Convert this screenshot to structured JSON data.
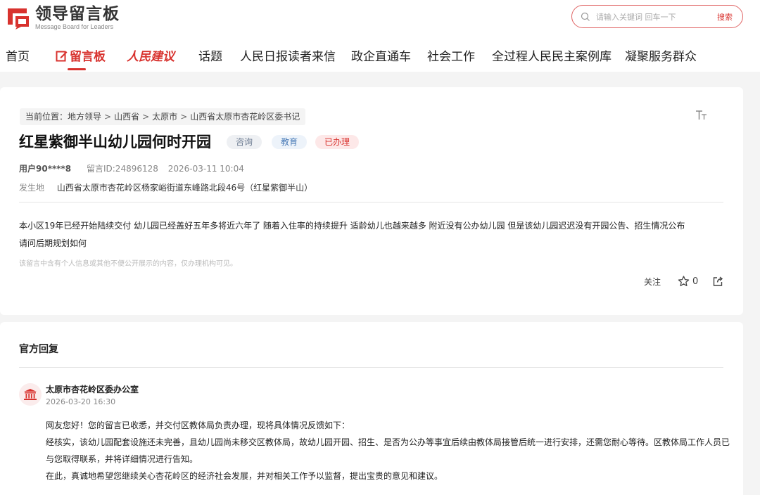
{
  "header": {
    "logo_title": "领导留言板",
    "logo_subtitle": "Message Board for Leaders",
    "search_placeholder": "请输入关键词 回车一下",
    "search_button": "搜索"
  },
  "nav": {
    "items": [
      {
        "label": "首页"
      },
      {
        "label": "留言板"
      },
      {
        "label": "人民建议"
      },
      {
        "label": "话题"
      },
      {
        "label": "人民日报读者来信"
      },
      {
        "label": "政企直通车"
      },
      {
        "label": "社会工作"
      },
      {
        "label": "全过程人民民主案例库"
      },
      {
        "label": "凝聚服务群众"
      }
    ]
  },
  "breadcrumb": {
    "prefix": "当前位置：",
    "items": [
      "地方领导",
      "山西省",
      "太原市",
      "山西省太原市杏花岭区委书记"
    ],
    "separator": ">"
  },
  "message": {
    "title": "红星紫御半山幼儿园何时开园",
    "tags": [
      "咨询",
      "教育",
      "已办理"
    ],
    "user": "用户90****8",
    "message_id": "留言ID:24896128",
    "datetime": "2026-03-11 10:04",
    "location_label": "发生地",
    "location": "山西省太原市杏花岭区杨家峪街道东峰路北段46号（红星紫御半山）",
    "content_line1": "本小区19年已经开始陆续交付 幼儿园已经盖好五年多将近六年了 随着入住率的持续提升 适龄幼儿也越来越多 附近没有公办幼儿园 但是该幼儿园迟迟没有开园公告、招生情况公布",
    "content_line2": "请问后期规划如何",
    "notice": "该留言中含有个人信息或其他不便公开展示的内容，仅办理机构可见。",
    "follow_label": "关注",
    "star_count": "0"
  },
  "reply": {
    "section_title": "官方回复",
    "org": "太原市杏花岭区委办公室",
    "datetime": "2026-03-20 16:30",
    "paragraphs": [
      "网友您好！您的留言已收悉，并交付区教体局负责办理，现将具体情况反馈如下：",
      "经核实，该幼儿园配套设施还未完善，且幼儿园尚未移交区教体局，故幼儿园开园、招生、是否为公办等事宜后续由教体局接管后统一进行安排，还需您耐心等待。区教体局工作人员已与您取得联系，并将详细情况进行告知。",
      "在此，真诚地希望您继续关心杏花岭区的经济社会发展，并对相关工作予以监督，提出宝贵的意见和建议。"
    ]
  },
  "colors": {
    "brand": "#d8322e",
    "background": "#f4f4f4"
  }
}
